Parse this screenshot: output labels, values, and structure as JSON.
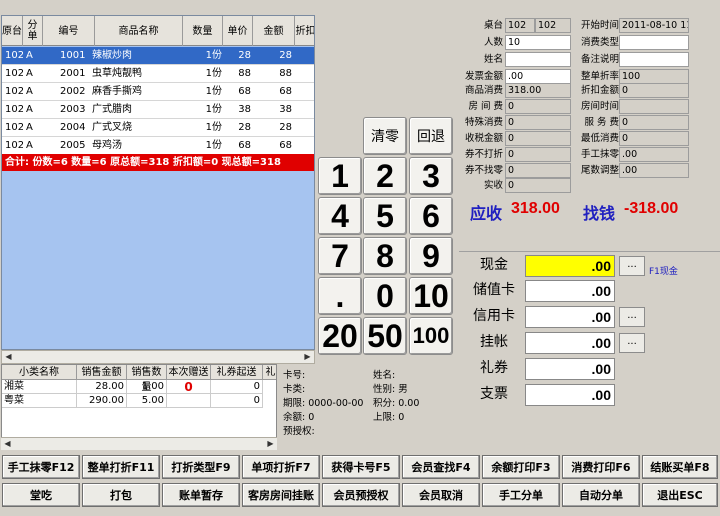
{
  "order_grid": {
    "headers": [
      "原台",
      "分单",
      "编号",
      "商品名称",
      "数量",
      "单价",
      "金额",
      "折扣"
    ],
    "rows": [
      {
        "table": "102",
        "split": "A",
        "code": "1001",
        "name": "辣椒炒肉",
        "qty": "1份",
        "price": "28",
        "amount": "28",
        "selected": true
      },
      {
        "table": "102",
        "split": "A",
        "code": "2001",
        "name": "虫草炖靓鸭",
        "qty": "1份",
        "price": "88",
        "amount": "88"
      },
      {
        "table": "102",
        "split": "A",
        "code": "2002",
        "name": "麻香手撕鸡",
        "qty": "1份",
        "price": "68",
        "amount": "68"
      },
      {
        "table": "102",
        "split": "A",
        "code": "2003",
        "name": "广式腊肉",
        "qty": "1份",
        "price": "38",
        "amount": "38"
      },
      {
        "table": "102",
        "split": "A",
        "code": "2004",
        "name": "广式叉烧",
        "qty": "1份",
        "price": "28",
        "amount": "28"
      },
      {
        "table": "102",
        "split": "A",
        "code": "2005",
        "name": "母鸡汤",
        "qty": "1份",
        "price": "68",
        "amount": "68"
      }
    ],
    "totals": "合计:   份数=6  数量=6  原总额=318  折扣额=0  现总额=318"
  },
  "sub_grid": {
    "headers": [
      "小类名称",
      "销售金额",
      "销售数量",
      "本次赠送",
      "礼券起送",
      "礼"
    ],
    "rows": [
      {
        "name": "湘菜",
        "amount": "28.00",
        "qty": "1.00",
        "gift": "0",
        "coupon": "0"
      },
      {
        "name": "粤菜",
        "amount": "290.00",
        "qty": "5.00",
        "gift": "",
        "coupon": "0"
      }
    ]
  },
  "member": {
    "card_no": "卡号:",
    "card_type": "卡类:",
    "expiry": "期限:  0000-00-00",
    "balance": "余额:  0",
    "preauth": "预授权:",
    "name": "姓名:",
    "gender": "性别: 男",
    "points": "积分:  0.00",
    "limit": "上限:  0"
  },
  "keypad": {
    "clear": "清零",
    "back": "回退",
    "keys": [
      "1",
      "2",
      "3",
      "4",
      "5",
      "6",
      "7",
      "8",
      "9",
      ".",
      "0",
      "10",
      "20",
      "50",
      "100"
    ]
  },
  "bill": {
    "table_label": "桌台",
    "table_val1": "102",
    "table_val2": "102",
    "start_label": "开始时间",
    "start_val": "2011-08-10 11:3",
    "people_label": "人数",
    "people_val": "10",
    "consume_type_label": "消费类型",
    "consume_type_val": "",
    "name_label": "姓名",
    "name_val": "",
    "remark_label": "备注说明",
    "remark_val": "",
    "invoice_label": "发票金额",
    "invoice_val": ".00",
    "whole_rate_label": "整单折率",
    "whole_rate_val": "100",
    "goods_label": "商品消费",
    "goods_val": "318.00",
    "discount_label": "折扣金额",
    "discount_val": "0",
    "room_fee_label": "房 间 费",
    "room_fee_val": "0",
    "room_time_label": "房间时间",
    "room_time_val": "",
    "special_label": "特殊消费",
    "special_val": "0",
    "service_label": "服 务 费",
    "service_val": "0",
    "tax_label": "收税金额",
    "tax_val": "0",
    "min_label": "最低消费",
    "min_val": "0",
    "coupon_nd_label": "券不打折",
    "coupon_nd_val": "0",
    "manual_round_label": "手工抹零",
    "manual_round_val": ".00",
    "coupon_nc_label": "券不找零",
    "coupon_nc_val": "0",
    "tail_label": "尾数调整",
    "tail_val": ".00",
    "actual_label": "实收",
    "actual_val": "0"
  },
  "due": {
    "label": "应收",
    "value": "318.00",
    "change_label": "找钱",
    "change_value": "-318.00"
  },
  "payment": {
    "cash_label": "现金",
    "cash_val": ".00",
    "cash_hint": "F1现金",
    "stored_label": "储值卡",
    "stored_val": ".00",
    "credit_label": "信用卡",
    "credit_val": ".00",
    "account_label": "挂帐",
    "account_val": ".00",
    "gift_label": "礼券",
    "gift_val": ".00",
    "check_label": "支票",
    "check_val": ".00",
    "dots": "..."
  },
  "buttons_row1": [
    "手工抹零F12",
    "整单打折F11",
    "打折类型F9",
    "单项打折F7",
    "获得卡号F5",
    "会员查找F4",
    "余额打印F3",
    "消费打印F6",
    "结账买单F8"
  ],
  "buttons_row2": [
    "堂吃",
    "打包",
    "账单暂存",
    "客房房间挂账",
    "会员预授权",
    "会员取消",
    "手工分单",
    "自动分单",
    "退出ESC"
  ],
  "colors": {
    "selected_row": "#3169c6",
    "totals_bar": "#e00000",
    "due_value": "#e00000",
    "label_blue": "#2020c0",
    "cash_highlight": "#ffff00"
  }
}
